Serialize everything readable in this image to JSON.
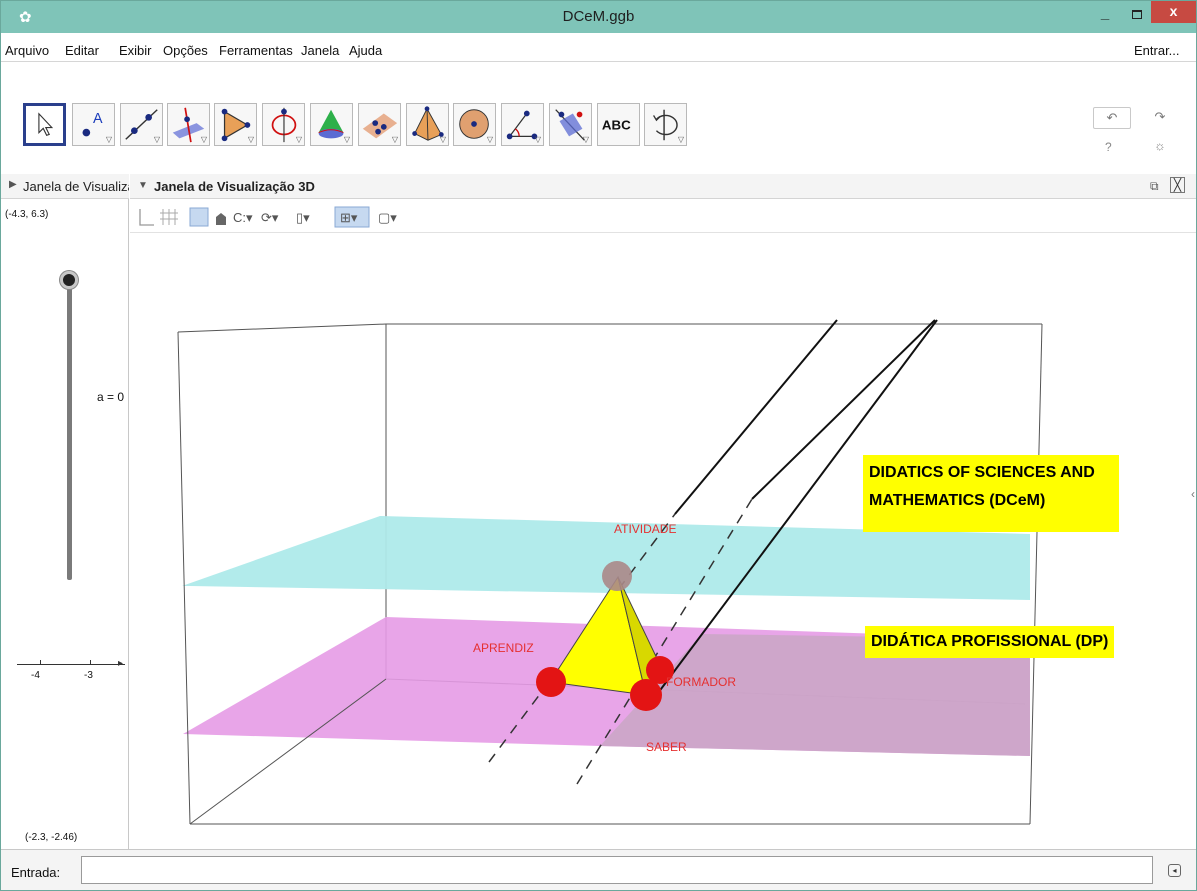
{
  "window": {
    "title": "DCeM.ggb",
    "close_glyph": "x",
    "min_glyph": "_"
  },
  "menu": {
    "items": [
      "Arquivo",
      "Editar",
      "Exibir",
      "Opções",
      "Ferramentas",
      "Janela",
      "Ajuda"
    ],
    "login": "Entrar..."
  },
  "toolbar": {
    "tools": [
      {
        "icon": "move-arrow-icon"
      },
      {
        "icon": "point-icon",
        "text": "A"
      },
      {
        "icon": "line-icon"
      },
      {
        "icon": "perpendicular-line-icon"
      },
      {
        "icon": "polygon-icon"
      },
      {
        "icon": "circle-axis-icon"
      },
      {
        "icon": "cone-icon"
      },
      {
        "icon": "plane-points-icon"
      },
      {
        "icon": "pyramid-icon"
      },
      {
        "icon": "sphere-icon"
      },
      {
        "icon": "angle-icon"
      },
      {
        "icon": "reflect-plane-icon"
      },
      {
        "icon": "text-tool-icon",
        "text": "ABC"
      },
      {
        "icon": "rotate-view-icon"
      }
    ],
    "undo_glyph": "↶",
    "redo_glyph": "↷",
    "help_glyph": "?",
    "settings_glyph": "☼"
  },
  "left_panel": {
    "title": "Janela de Visualização",
    "coord_top": "(-4.3, 6.3)",
    "coord_bottom": "(-2.3, -2.46)",
    "slider_label": "a = 0",
    "tick_labels": [
      "-4",
      "-3"
    ]
  },
  "view3d": {
    "title": "Janela de Visualização 3D",
    "labels": {
      "dcem": "DIDATICS OF SCIENCES AND MATHEMATICS (DCeM)",
      "dp": "DIDÁTICA PROFISSIONAL (DP)",
      "atividade": "ATIVIDADE",
      "aprendiz": "APRENDIZ",
      "formador": "FORMADOR",
      "saber": "SABER"
    },
    "colors": {
      "upper_plane": "#aeeaea",
      "lower_plane": "#e69be6",
      "tetrahedron": "#ffff00",
      "point": "#e31414",
      "label": "#e53030"
    }
  },
  "input_bar": {
    "label": "Entrada:",
    "value": ""
  }
}
